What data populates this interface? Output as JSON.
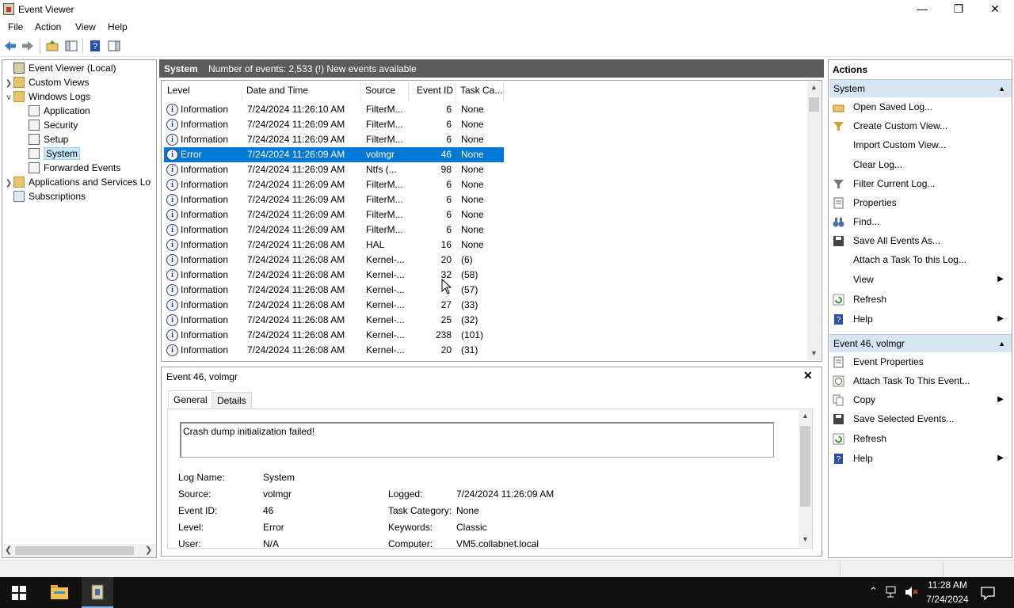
{
  "window": {
    "title": "Event Viewer"
  },
  "menu": [
    "File",
    "Action",
    "View",
    "Help"
  ],
  "tree": {
    "root": "Event Viewer (Local)",
    "custom_views": "Custom Views",
    "windows_logs": "Windows Logs",
    "logs": [
      "Application",
      "Security",
      "Setup",
      "System",
      "Forwarded Events"
    ],
    "apps_services": "Applications and Services Lo",
    "subscriptions": "Subscriptions"
  },
  "center": {
    "log_name": "System",
    "summary": "Number of events: 2,533 (!) New events available",
    "columns": [
      "Level",
      "Date and Time",
      "Source",
      "Event ID",
      "Task Ca..."
    ],
    "rows": [
      {
        "level": "Information",
        "date": "7/24/2024 11:26:10 AM",
        "source": "FilterM...",
        "id": "6",
        "task": "None"
      },
      {
        "level": "Information",
        "date": "7/24/2024 11:26:09 AM",
        "source": "FilterM...",
        "id": "6",
        "task": "None"
      },
      {
        "level": "Information",
        "date": "7/24/2024 11:26:09 AM",
        "source": "FilterM...",
        "id": "6",
        "task": "None"
      },
      {
        "level": "Error",
        "date": "7/24/2024 11:26:09 AM",
        "source": "volmgr",
        "id": "46",
        "task": "None"
      },
      {
        "level": "Information",
        "date": "7/24/2024 11:26:09 AM",
        "source": "Ntfs (...",
        "id": "98",
        "task": "None"
      },
      {
        "level": "Information",
        "date": "7/24/2024 11:26:09 AM",
        "source": "FilterM...",
        "id": "6",
        "task": "None"
      },
      {
        "level": "Information",
        "date": "7/24/2024 11:26:09 AM",
        "source": "FilterM...",
        "id": "6",
        "task": "None"
      },
      {
        "level": "Information",
        "date": "7/24/2024 11:26:09 AM",
        "source": "FilterM...",
        "id": "6",
        "task": "None"
      },
      {
        "level": "Information",
        "date": "7/24/2024 11:26:09 AM",
        "source": "FilterM...",
        "id": "6",
        "task": "None"
      },
      {
        "level": "Information",
        "date": "7/24/2024 11:26:08 AM",
        "source": "HAL",
        "id": "16",
        "task": "None"
      },
      {
        "level": "Information",
        "date": "7/24/2024 11:26:08 AM",
        "source": "Kernel-...",
        "id": "20",
        "task": "(6)"
      },
      {
        "level": "Information",
        "date": "7/24/2024 11:26:08 AM",
        "source": "Kernel-...",
        "id": "32",
        "task": "(58)"
      },
      {
        "level": "Information",
        "date": "7/24/2024 11:26:08 AM",
        "source": "Kernel-...",
        "id": "",
        "task": "(57)"
      },
      {
        "level": "Information",
        "date": "7/24/2024 11:26:08 AM",
        "source": "Kernel-...",
        "id": "27",
        "task": "(33)"
      },
      {
        "level": "Information",
        "date": "7/24/2024 11:26:08 AM",
        "source": "Kernel-...",
        "id": "25",
        "task": "(32)"
      },
      {
        "level": "Information",
        "date": "7/24/2024 11:26:08 AM",
        "source": "Kernel-...",
        "id": "238",
        "task": "(101)"
      },
      {
        "level": "Information",
        "date": "7/24/2024 11:26:08 AM",
        "source": "Kernel-...",
        "id": "20",
        "task": "(31)"
      }
    ]
  },
  "detail": {
    "title": "Event 46, volmgr",
    "tabs": [
      "General",
      "Details"
    ],
    "message": "Crash dump initialization failed!",
    "fields": {
      "log_name_label": "Log Name:",
      "log_name": "System",
      "source_label": "Source:",
      "source": "volmgr",
      "event_id_label": "Event ID:",
      "event_id": "46",
      "level_label": "Level:",
      "level": "Error",
      "user_label": "User:",
      "user": "N/A",
      "logged_label": "Logged:",
      "logged": "7/24/2024 11:26:09 AM",
      "task_label": "Task Category:",
      "task": "None",
      "keywords_label": "Keywords:",
      "keywords": "Classic",
      "computer_label": "Computer:",
      "computer": "VM5.collabnet.local"
    }
  },
  "actions": {
    "header": "Actions",
    "section1": "System",
    "items1": [
      "Open Saved Log...",
      "Create Custom View...",
      "Import Custom View...",
      "Clear Log...",
      "Filter Current Log...",
      "Properties",
      "Find...",
      "Save All Events As...",
      "Attach a Task To this Log...",
      "View",
      "Refresh",
      "Help"
    ],
    "section2": "Event 46, volmgr",
    "items2": [
      "Event Properties",
      "Attach Task To This Event...",
      "Copy",
      "Save Selected Events...",
      "Refresh",
      "Help"
    ]
  },
  "taskbar": {
    "time": "11:28 AM",
    "date": "7/24/2024"
  }
}
